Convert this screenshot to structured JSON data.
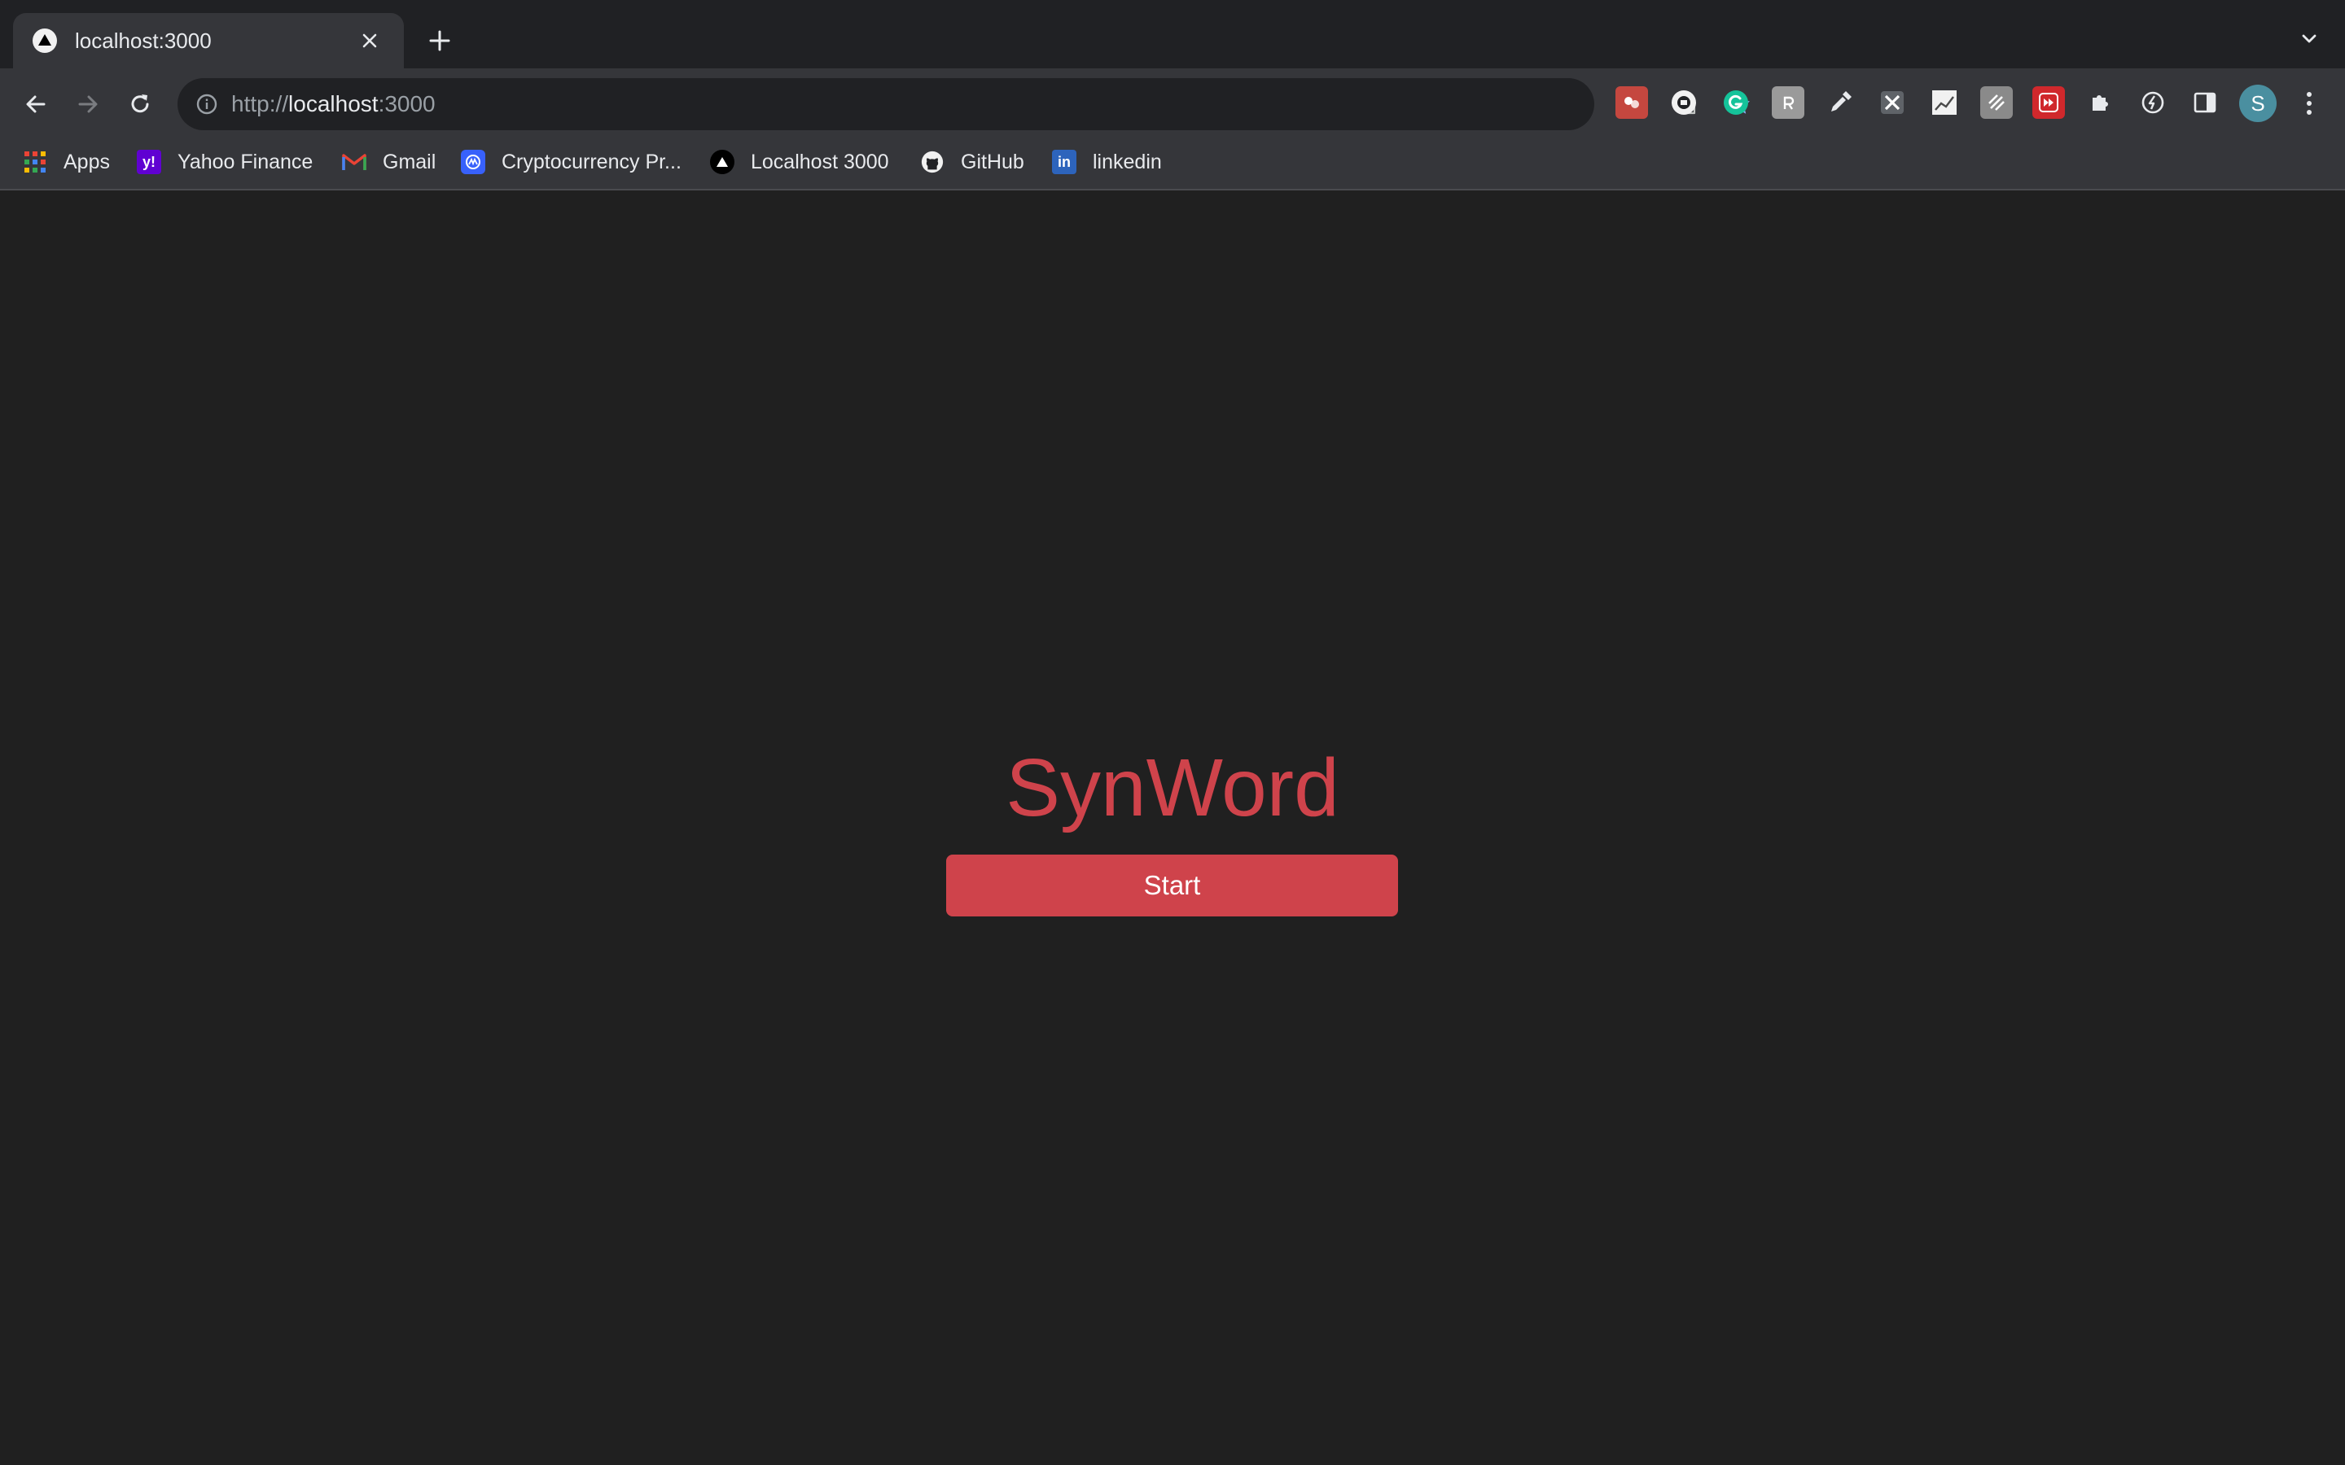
{
  "tab": {
    "title": "localhost:3000"
  },
  "omnibox": {
    "scheme": "http://",
    "host": "localhost",
    "port": ":3000"
  },
  "bookmarks": [
    {
      "label": "Apps",
      "icon": "apps-grid-icon"
    },
    {
      "label": "Yahoo Finance",
      "icon": "yahoo-icon"
    },
    {
      "label": "Gmail",
      "icon": "gmail-icon"
    },
    {
      "label": "Cryptocurrency Pr...",
      "icon": "coinmarketcap-icon"
    },
    {
      "label": "Localhost 3000",
      "icon": "triangle-icon"
    },
    {
      "label": "GitHub",
      "icon": "github-icon"
    },
    {
      "label": "linkedin",
      "icon": "linkedin-icon"
    }
  ],
  "profile": {
    "initial": "S"
  },
  "app": {
    "title": "SynWord",
    "start_label": "Start"
  },
  "colors": {
    "accent": "#cf434b",
    "page_background": "#202020",
    "toolbar": "#35363a",
    "tabstrip": "#202124",
    "star": "#8ab4f8"
  }
}
